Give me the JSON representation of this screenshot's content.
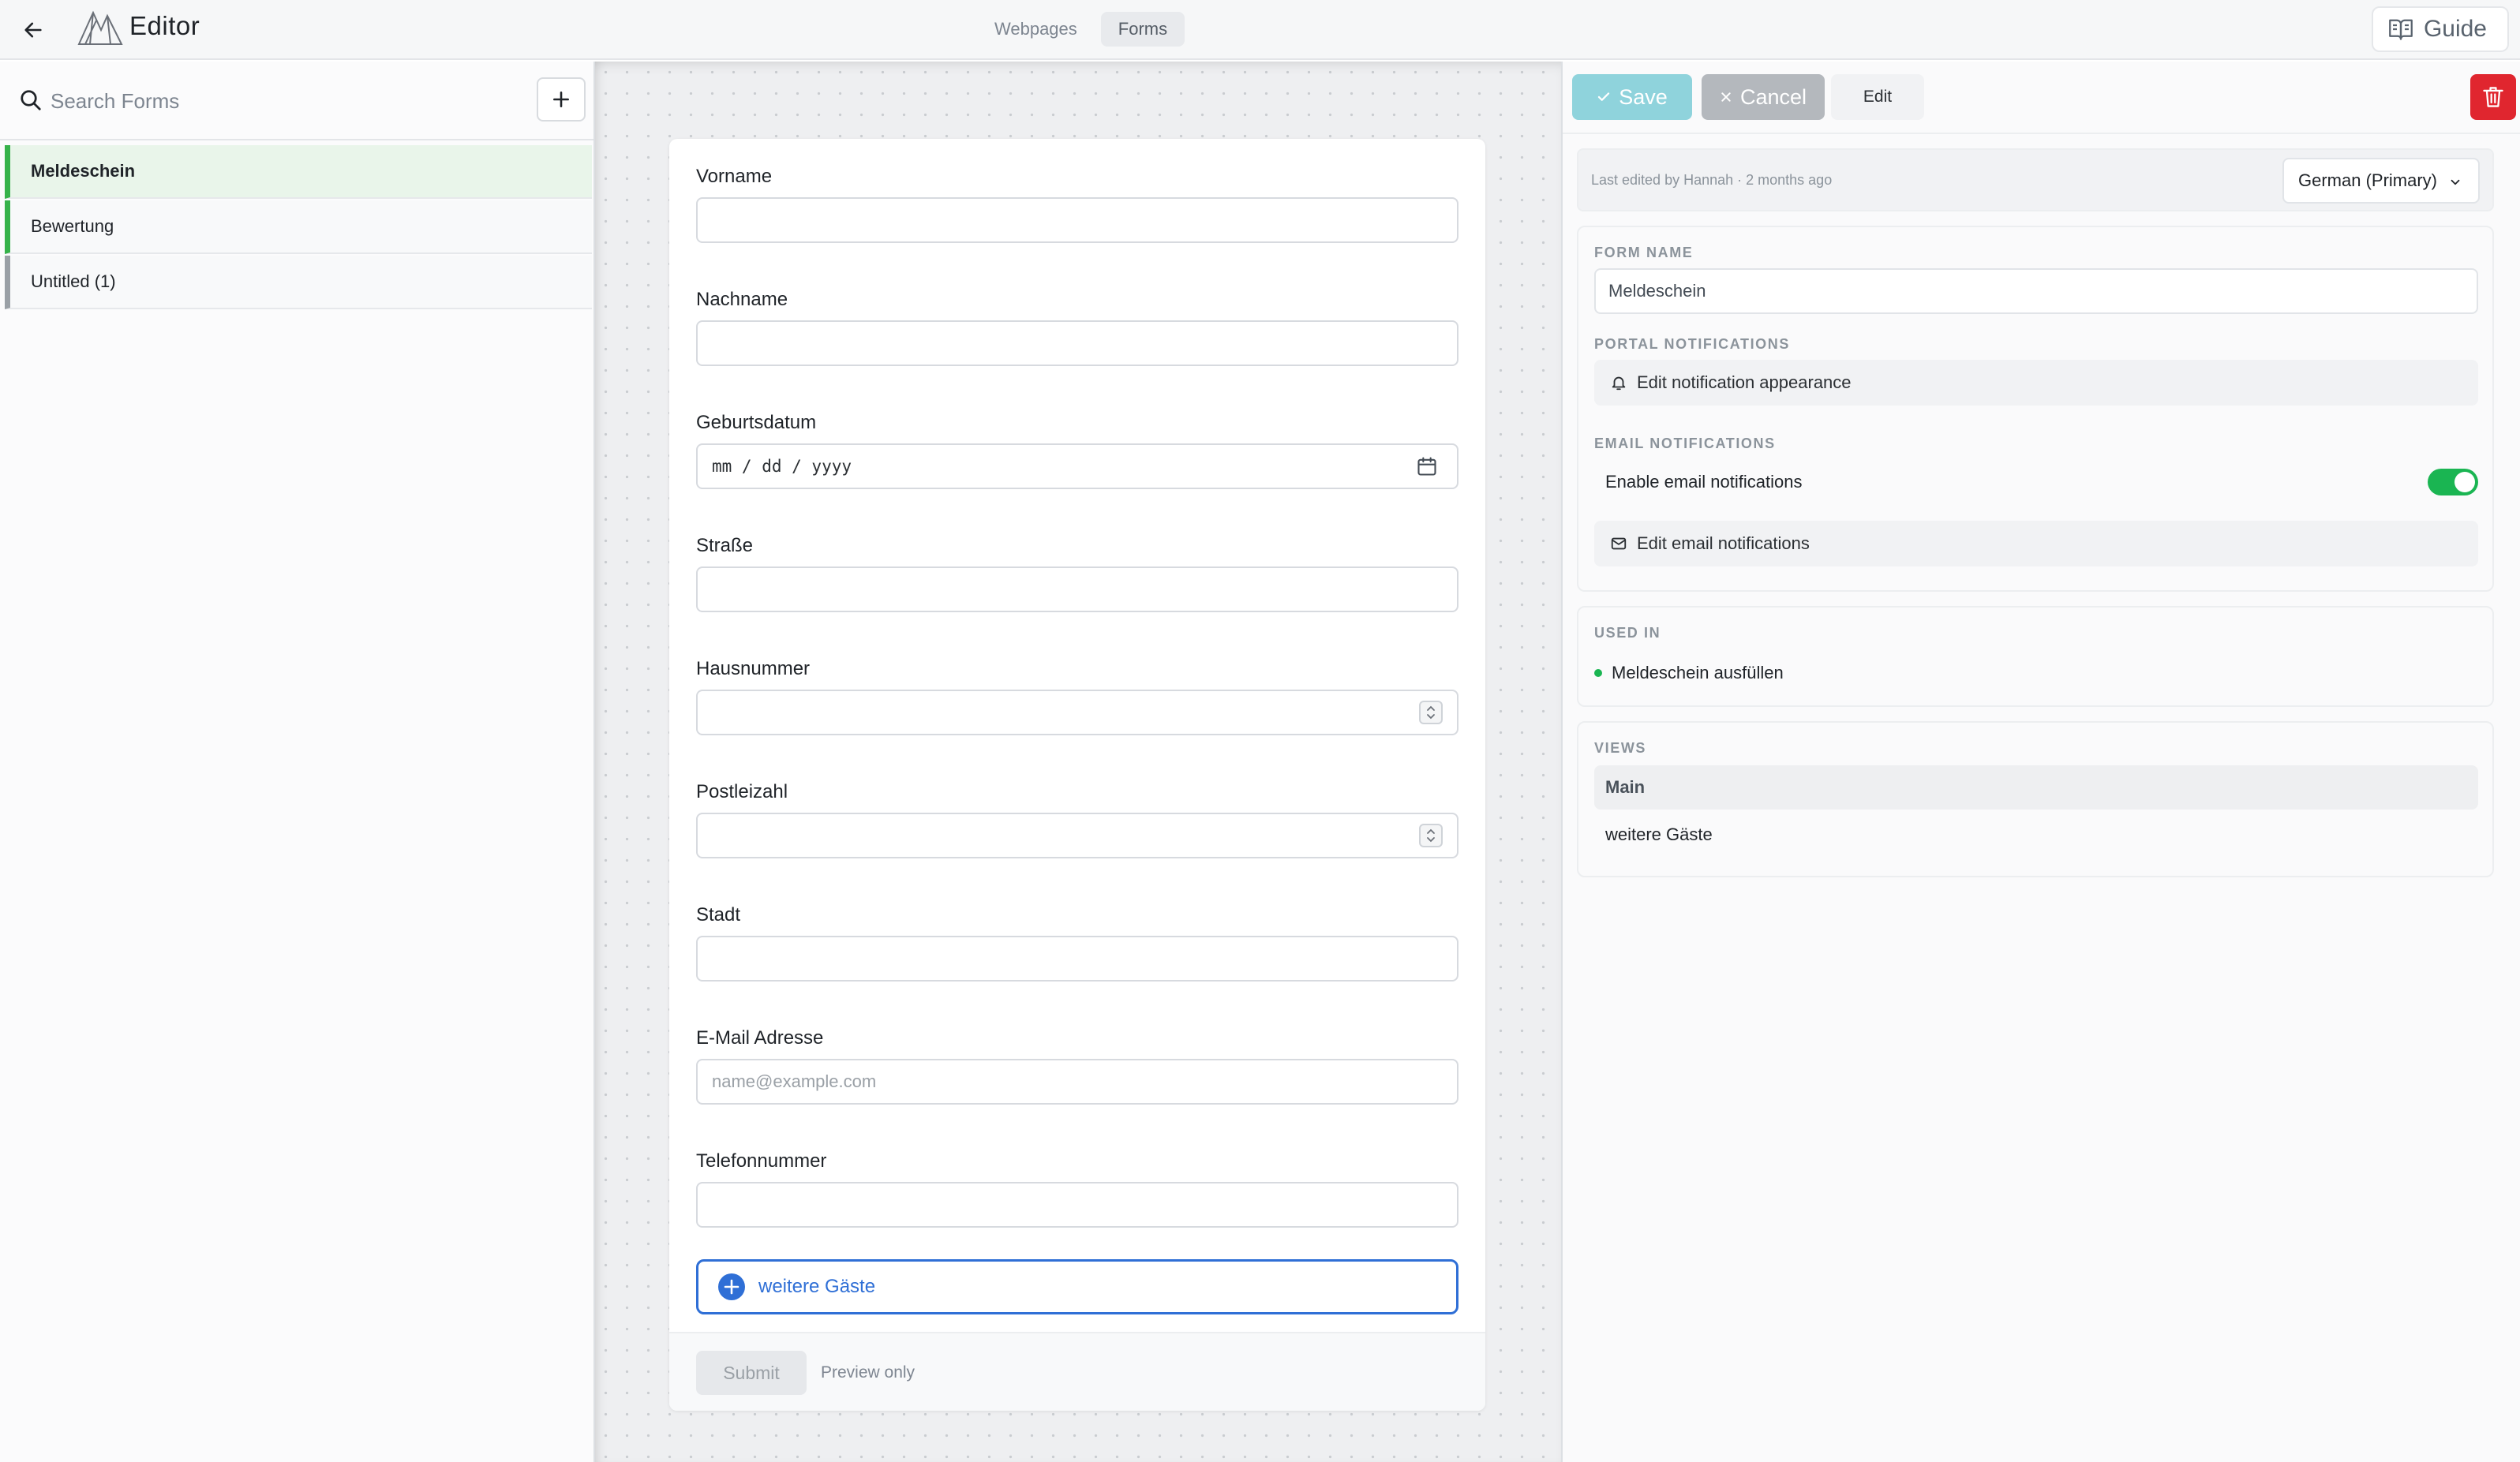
{
  "topbar": {
    "title": "Editor",
    "tabs": [
      {
        "label": "Webpages",
        "active": false
      },
      {
        "label": "Forms",
        "active": true
      }
    ],
    "guide_label": "Guide"
  },
  "sidebar": {
    "search_placeholder": "Search Forms",
    "forms": [
      {
        "label": "Meldeschein",
        "selected": true
      },
      {
        "label": "Bewertung",
        "selected": false
      },
      {
        "label": "Untitled (1)",
        "selected": false
      }
    ]
  },
  "form": {
    "fields": [
      {
        "label": "Vorname",
        "type": "text",
        "value": ""
      },
      {
        "label": "Nachname",
        "type": "text",
        "value": ""
      },
      {
        "label": "Geburtsdatum",
        "type": "date",
        "mask": "mm / dd / yyyy"
      },
      {
        "label": "Straße",
        "type": "text",
        "value": ""
      },
      {
        "label": "Hausnummer",
        "type": "number",
        "value": ""
      },
      {
        "label": "Postleizahl",
        "type": "number",
        "value": ""
      },
      {
        "label": "Stadt",
        "type": "text",
        "value": ""
      },
      {
        "label": "E-Mail Adresse",
        "type": "email",
        "placeholder": "name@example.com"
      },
      {
        "label": "Telefonnummer",
        "type": "text",
        "value": ""
      }
    ],
    "guests_button": "weitere Gäste",
    "submit_label": "Submit",
    "preview_note": "Preview only"
  },
  "panel": {
    "save_label": "Save",
    "cancel_label": "Cancel",
    "edit_label": "Edit",
    "last_edited": "Last edited by Hannah · 2 months ago",
    "language": "German (Primary)",
    "form_name_heading": "FORM NAME",
    "form_name_value": "Meldeschein",
    "portal_heading": "PORTAL NOTIFICATIONS",
    "portal_action": "Edit notification appearance",
    "email_heading": "EMAIL NOTIFICATIONS",
    "email_toggle_label": "Enable email notifications",
    "email_toggle_on": true,
    "email_action": "Edit email notifications",
    "used_in_heading": "USED IN",
    "used_in": [
      "Meldeschein ausfüllen"
    ],
    "views_heading": "VIEWS",
    "views": [
      {
        "label": "Main",
        "active": true
      },
      {
        "label": "weitere Gäste",
        "active": false
      }
    ]
  },
  "colors": {
    "accent_green": "#1ab552",
    "accent_blue": "#2f6fd6",
    "save_button": "#8fd3dc",
    "delete_button": "#e0262f"
  },
  "icons": [
    "back-arrow-icon",
    "logo-icon",
    "book-icon",
    "search-icon",
    "plus-icon",
    "calendar-icon",
    "spinner-icon",
    "plus-circle-icon",
    "check-icon",
    "close-icon",
    "trash-icon",
    "chevron-down-icon",
    "bell-icon",
    "mail-icon"
  ]
}
